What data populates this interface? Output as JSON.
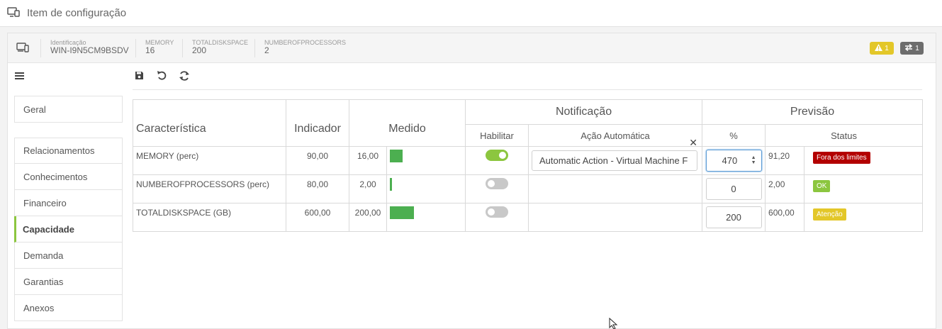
{
  "page": {
    "title": "Item de configuração"
  },
  "infobar": {
    "fields": [
      {
        "label": "Identificação",
        "value": "WIN-I9N5CM9BSDV"
      },
      {
        "label": "MEMORY",
        "value": "16"
      },
      {
        "label": "TOTALDISKSPACE",
        "value": "200"
      },
      {
        "label": "NUMBEROFPROCESSORS",
        "value": "2"
      }
    ],
    "badges": {
      "warning_count": "1",
      "sync_count": "1",
      "warning_color": "#e3c729",
      "sync_color": "#6d6d6d"
    }
  },
  "sidebar": {
    "top": {
      "label": "Geral"
    },
    "items": [
      {
        "label": "Relacionamentos",
        "active": false
      },
      {
        "label": "Conhecimentos",
        "active": false
      },
      {
        "label": "Financeiro",
        "active": false
      },
      {
        "label": "Capacidade",
        "active": true
      },
      {
        "label": "Demanda",
        "active": false
      },
      {
        "label": "Garantias",
        "active": false
      },
      {
        "label": "Anexos",
        "active": false
      }
    ],
    "active_color": "#8cc63f"
  },
  "toolbar": {
    "icons": [
      "save-icon",
      "undo-icon",
      "refresh-icon"
    ]
  },
  "table": {
    "headers": {
      "caracteristica": "Característica",
      "indicador": "Indicador",
      "medido": "Medido",
      "notificacao": "Notificação",
      "previsao": "Previsão",
      "habilitar": "Habilitar",
      "acao": "Ação Automática",
      "pct": "%",
      "status": "Status"
    },
    "rows": [
      {
        "name": "MEMORY (perc)",
        "indicador": "90,00",
        "medido": "16,00",
        "bar_fraction": 0.178,
        "habilitar": true,
        "acao": "Automatic Action - Virtual Machine F",
        "pct": "470",
        "previsao": "91,20",
        "status": "Fora dos limites",
        "status_color": "#b30000"
      },
      {
        "name": "NUMBEROFPROCESSORS (perc)",
        "indicador": "80,00",
        "medido": "2,00",
        "bar_fraction": 0.025,
        "habilitar": false,
        "acao": "",
        "pct": "0",
        "previsao": "2,00",
        "status": "OK",
        "status_color": "#8cc63f"
      },
      {
        "name": "TOTALDISKSPACE (GB)",
        "indicador": "600,00",
        "medido": "200,00",
        "bar_fraction": 0.333,
        "habilitar": false,
        "acao": "",
        "pct": "200",
        "previsao": "600,00",
        "status": "Atenção",
        "status_color": "#e3c729"
      }
    ],
    "bar_color": "#4caf50"
  }
}
